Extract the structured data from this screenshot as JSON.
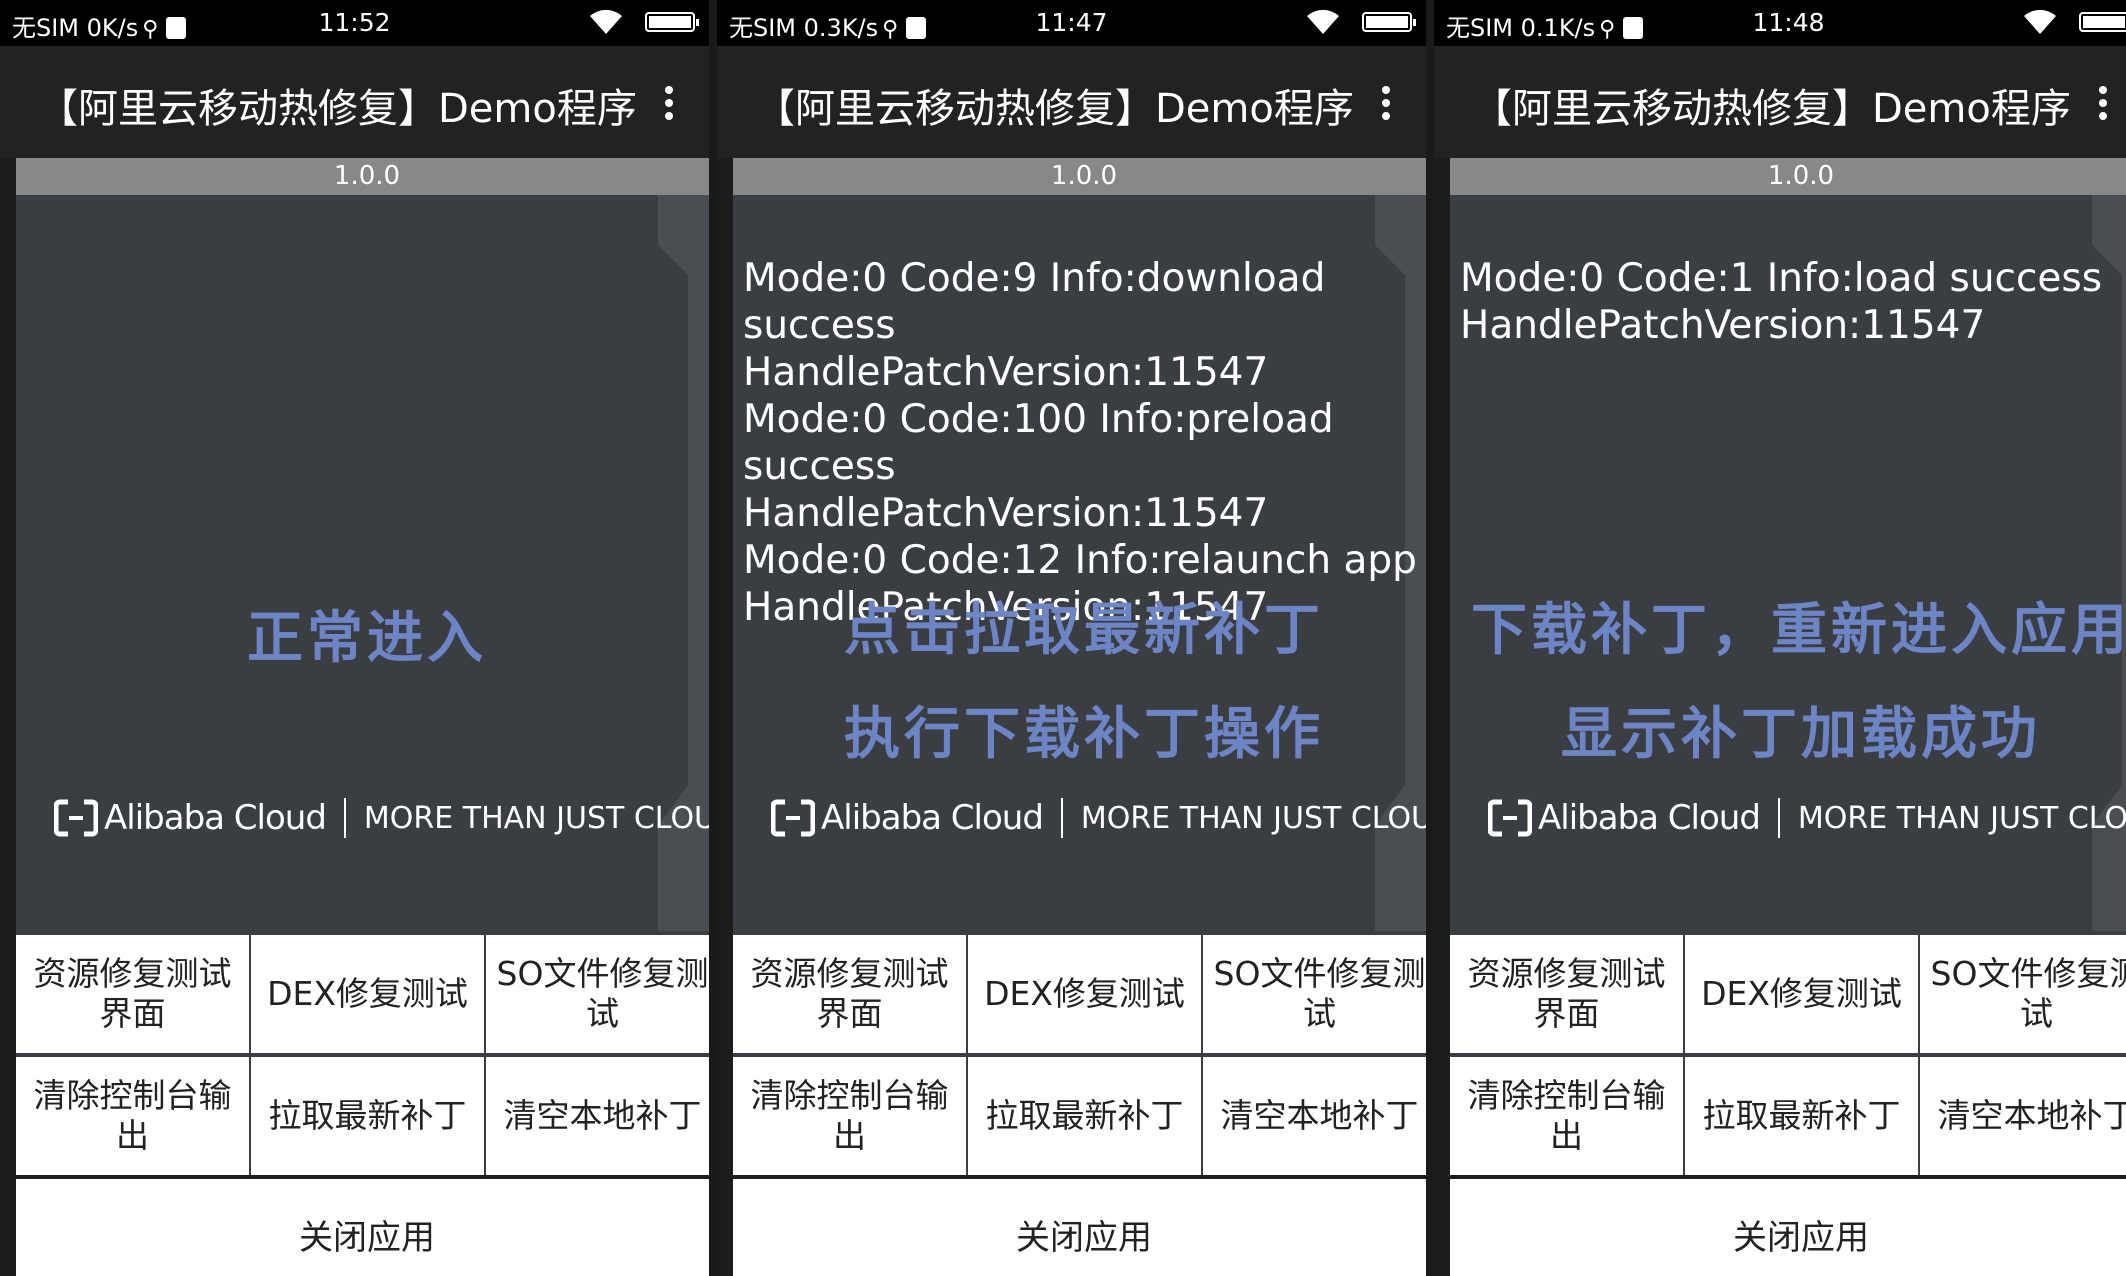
{
  "screens": [
    {
      "status": {
        "carrier": "无SIM 0K/s",
        "time": "11:52"
      },
      "app_title": "【阿里云移动热修复】Demo程序",
      "version": "1.0.0",
      "log_lines": [],
      "captions": [
        "正常进入"
      ],
      "brand": {
        "name": "Alibaba Cloud",
        "slogan": "MORE THAN JUST CLOUD"
      },
      "buttons": [
        "资源修复测试界面",
        "DEX修复测试",
        "SO文件修复测试",
        "清除控制台输出",
        "拉取最新补丁",
        "清空本地补丁"
      ],
      "close_label": "关闭应用"
    },
    {
      "status": {
        "carrier": "无SIM 0.3K/s",
        "time": "11:47"
      },
      "app_title": "【阿里云移动热修复】Demo程序",
      "version": "1.0.0",
      "log_lines": [
        "Mode:0 Code:9 Info:download success HandlePatchVersion:11547",
        "Mode:0 Code:100 Info:preload success HandlePatchVersion:11547",
        "Mode:0 Code:12 Info:relaunch app HandlePatchVersion:11547"
      ],
      "captions": [
        "点击拉取最新补丁",
        "执行下载补丁操作"
      ],
      "brand": {
        "name": "Alibaba Cloud",
        "slogan": "MORE THAN JUST CLOUD"
      },
      "buttons": [
        "资源修复测试界面",
        "DEX修复测试",
        "SO文件修复测试",
        "清除控制台输出",
        "拉取最新补丁",
        "清空本地补丁"
      ],
      "close_label": "关闭应用"
    },
    {
      "status": {
        "carrier": "无SIM 0.1K/s",
        "time": "11:48"
      },
      "app_title": "【阿里云移动热修复】Demo程序",
      "version": "1.0.0",
      "log_lines": [
        "Mode:0 Code:1 Info:load success HandlePatchVersion:11547"
      ],
      "captions": [
        "下载补丁，重新进入应用",
        "显示补丁加载成功"
      ],
      "brand": {
        "name": "Alibaba Cloud",
        "slogan": "MORE THAN JUST CLOUD"
      },
      "buttons": [
        "资源修复测试界面",
        "DEX修复测试",
        "SO文件修复测试",
        "清除控制台输出",
        "拉取最新补丁",
        "清空本地补丁"
      ],
      "close_label": "关闭应用"
    }
  ]
}
